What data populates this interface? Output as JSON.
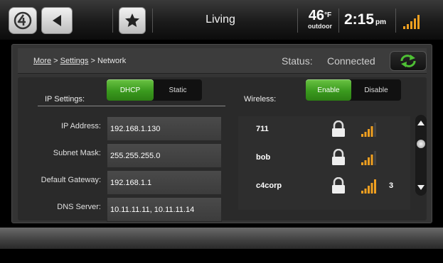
{
  "topbar": {
    "room_name": "Living",
    "temperature": "46",
    "temp_unit": "°F",
    "weather_label": "outdoor",
    "time": "2:15",
    "ampm": "pm"
  },
  "breadcrumb": {
    "more": "More",
    "separator1": ">",
    "settings": "Settings",
    "separator2": ">",
    "current": "Network"
  },
  "status": {
    "label": "Status:",
    "value": "Connected"
  },
  "ip_settings": {
    "label": "IP Settings:",
    "options": [
      "DHCP",
      "Static"
    ],
    "selected": "DHCP",
    "fields": [
      {
        "label": "IP Address:",
        "value": "192.168.1.130"
      },
      {
        "label": "Subnet Mask:",
        "value": "255.255.255.0"
      },
      {
        "label": "Default Gateway:",
        "value": "192.168.1.1"
      },
      {
        "label": "DNS Server:",
        "value": "10.11.11.11, 10.11.11.14"
      }
    ]
  },
  "wireless": {
    "label": "Wireless:",
    "options": [
      "Enable",
      "Disable"
    ],
    "selected": "Enable",
    "networks": [
      {
        "name": "711",
        "channel": ""
      },
      {
        "name": "bob",
        "channel": ""
      },
      {
        "name": "c4corp",
        "channel": "3"
      }
    ]
  },
  "colors": {
    "active_green": "#4aa82b",
    "signal_orange": "#f0a020",
    "background": "#000000"
  },
  "icons": {
    "logo": "c4-logo-icon",
    "back": "back-arrow-icon",
    "favorite": "star-icon",
    "signal": "signal-strength-icon",
    "refresh": "refresh-icon",
    "lock": "lock-icon"
  }
}
